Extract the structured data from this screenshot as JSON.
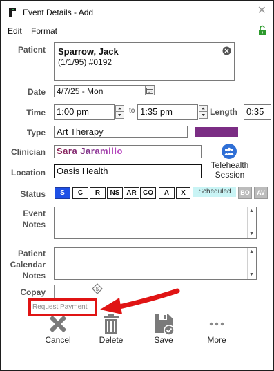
{
  "window": {
    "title": "Event Details - Add",
    "close_glyph": "✕"
  },
  "menu": {
    "items": [
      "Edit",
      "Format"
    ]
  },
  "patient": {
    "label": "Patient",
    "name": "Sparrow, Jack",
    "details": "(1/1/95) #0192"
  },
  "date": {
    "label": "Date",
    "value": "4/7/25 - Mon"
  },
  "time": {
    "label": "Time",
    "start": "1:00 pm",
    "to_label": "to",
    "end": "1:35 pm",
    "length_label": "Length",
    "length": "0:35"
  },
  "type": {
    "label": "Type",
    "value": "Art Therapy",
    "color": "#7b2d84"
  },
  "clinician": {
    "label": "Clinician",
    "value": "Sara Jaramillo"
  },
  "telehealth": {
    "label": "Telehealth Session"
  },
  "location": {
    "label": "Location",
    "value": "Oasis Health"
  },
  "status": {
    "label": "Status",
    "buttons": [
      "S",
      "C",
      "R",
      "NS",
      "AR",
      "CO",
      "A",
      "X"
    ],
    "active": "S",
    "active_color": "#1e50e6",
    "scheduled_text": "Scheduled",
    "extra": [
      "BO",
      "AV"
    ]
  },
  "event_notes": {
    "label_line1": "Event",
    "label_line2": "Notes",
    "value": ""
  },
  "patient_calendar_notes": {
    "label_line1": "Patient",
    "label_line2": "Calendar",
    "label_line3": "Notes",
    "value": ""
  },
  "copay": {
    "label": "Copay",
    "value": "",
    "request_payment": "Request Payment"
  },
  "actions": {
    "cancel": "Cancel",
    "delete": "Delete",
    "save": "Save",
    "more": "More"
  },
  "highlight_color": "#e01414"
}
